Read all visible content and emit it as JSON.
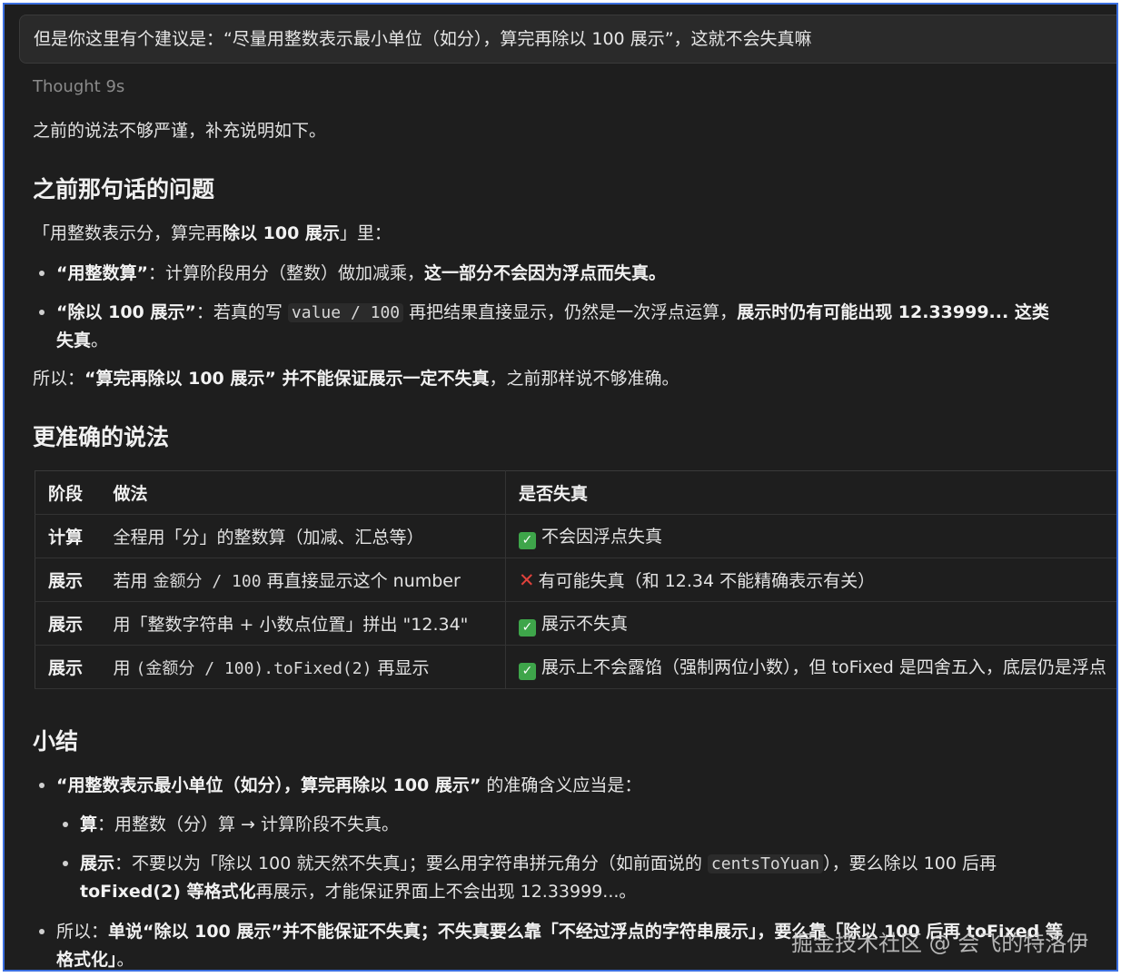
{
  "user_message": "但是你这里有个建议是：“尽量用整数表示最小单位（如分），算完再除以 100 展示”，这就不会失真嘛",
  "thought_label": "Thought 9s",
  "intro": "之前的说法不够严谨，补充说明如下。",
  "section1": {
    "heading": "之前那句话的问题",
    "lead_a": "「用整数表示分，算完再",
    "lead_b": "除以 100 展示",
    "lead_c": "」里：",
    "bullet1": {
      "bold": "“用整数算”",
      "text": "：计算阶段用分（整数）做加减乘，",
      "bold2": "这一部分不会因为浮点而失真。"
    },
    "bullet2": {
      "bold": "“除以 100 展示”",
      "text_a": "：若真的写 ",
      "code": "value / 100",
      "text_b": " 再把结果直接显示，仍然是一次浮点运算，",
      "bold2": "展示时仍有可能出现 12.33999... 这类",
      "bold3": "失真",
      "tail": "。"
    },
    "conclusion_a": "所以：",
    "conclusion_bold": "“算完再除以 100 展示” 并不能保证展示一定不失真",
    "conclusion_b": "，之前那样说不够准确。"
  },
  "section2": {
    "heading": "更准确的说法",
    "table": {
      "headers": [
        "阶段",
        "做法",
        "是否失真"
      ],
      "rows": [
        {
          "stage": "计算",
          "method": "全程用「分」的整数算（加减、汇总等）",
          "mark": "ok",
          "result": "不会因浮点失真"
        },
        {
          "stage": "展示",
          "method_a": "若用 ",
          "method_code": "金额分 / 100",
          "method_b": " 再直接显示这个 number",
          "mark": "x",
          "result": "有可能失真（和 12.34 不能精确表示有关）"
        },
        {
          "stage": "展示",
          "method": "用「整数字符串 + 小数点位置」拼出 \"12.34\"",
          "mark": "ok",
          "result": "展示不失真"
        },
        {
          "stage": "展示",
          "method_a": "用 ",
          "method_code": "(金额分 / 100).toFixed(2)",
          "method_b": " 再显示",
          "mark": "ok",
          "result": "展示上不会露馅（强制两位小数），但 toFixed 是四舍五入，底层仍是浮点"
        }
      ]
    }
  },
  "section3": {
    "heading": "小结",
    "bullet1_bold": "“用整数表示最小单位（如分），算完再除以 100 展示”",
    "bullet1_text": " 的准确含义应当是：",
    "sub1_bold": "算",
    "sub1_text": "：用整数（分）算 → 计算阶段不失真。",
    "sub2_bold": "展示",
    "sub2_text_a": "：不要以为「除以 100 就天然不失真」；要么用字符串拼元角分（如前面说的 ",
    "sub2_code": "centsToYuan",
    "sub2_text_b": "），要么除以 100 后再",
    "sub2_line2_bold": "toFixed(2) 等格式化",
    "sub2_line2_text": "再展示，才能保证界面上不会出现 12.33999...。",
    "bullet2_a": "所以：",
    "bullet2_bold": "单说“除以 100 展示”并不能保证不失真；不失真要么靠「不经过浮点的字符串展示」，要么靠「除以 100 后再 toFixed 等",
    "bullet2_line2": "格式化」",
    "bullet2_tail": "。"
  },
  "watermark": "掘金技术社区 @ 会飞的特洛伊"
}
